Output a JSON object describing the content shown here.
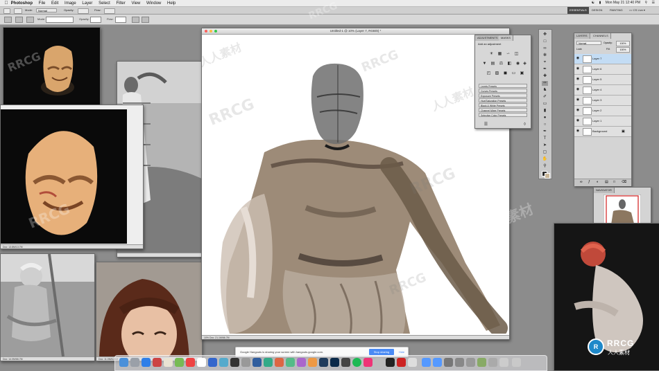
{
  "menubar": {
    "app_name": "Photoshop",
    "items": [
      "File",
      "Edit",
      "Image",
      "Layer",
      "Select",
      "Filter",
      "View",
      "Window",
      "Help"
    ],
    "clock": "Mon May 21 12:40 PM",
    "user": "☰"
  },
  "options_bar": {
    "mode_label": "Mode:",
    "mode_value": "Normal",
    "opacity_label": "Opacity:",
    "flow_label": "Flow:",
    "zoom": "100%"
  },
  "workspaces": {
    "essentials": "ESSENTIALS",
    "design": "DESIGN",
    "painting": "PAINTING",
    "more": ">>  CS Live ▾"
  },
  "canvas_window": {
    "title": "Untitled-1 @ 10% (Layer 7, RGB/8) *",
    "status": "10%        Doc: 21.1M/66.7M"
  },
  "ref_windows": {
    "mask_small_status": "",
    "mask_large_status": "Doc: 13.8M/13.7M",
    "boy_status": "Doc: 14.0M/66.7M",
    "woman_status": "Doc: 11.0M/6.24M"
  },
  "adjustments_panel": {
    "tabs": [
      "ADJUSTMENTS",
      "MASKS"
    ],
    "heading": "Add an adjustment",
    "presets": [
      "Levels Presets",
      "Curves Presets",
      "Exposure Presets",
      "Hue/Saturation Presets",
      "Black & White Presets",
      "Channel Mixer Presets",
      "Selective Color Presets"
    ]
  },
  "layers_panel": {
    "tabs": [
      "LAYERS",
      "CHANNELS"
    ],
    "blend_mode": "Normal",
    "opacity_label": "Opacity:",
    "opacity_value": "100%",
    "lock_label": "Lock:",
    "fill_label": "Fill:",
    "fill_value": "100%",
    "layers": [
      "Layer 7",
      "Layer 6",
      "Layer 5",
      "Layer 4",
      "Layer 3",
      "Layer 2",
      "Layer 1",
      "Background"
    ]
  },
  "navigator_panel": {
    "tabs": [
      "NAVIGATOR"
    ],
    "zoom": "10%"
  },
  "hangouts_bar": {
    "message": "Google Hangouts is sharing your screen with hangouts.google.com.",
    "stop_label": "Stop sharing",
    "hide_label": "Hide"
  },
  "watermark": {
    "text": "RRCG",
    "cn_text": "人人素材",
    "brand_sub": "人人素材"
  },
  "icons": [
    "apple-icon",
    "wifi-icon",
    "battery-icon",
    "spotlight-icon",
    "eye-icon",
    "brush-icon",
    "lasso-icon",
    "move-icon"
  ]
}
